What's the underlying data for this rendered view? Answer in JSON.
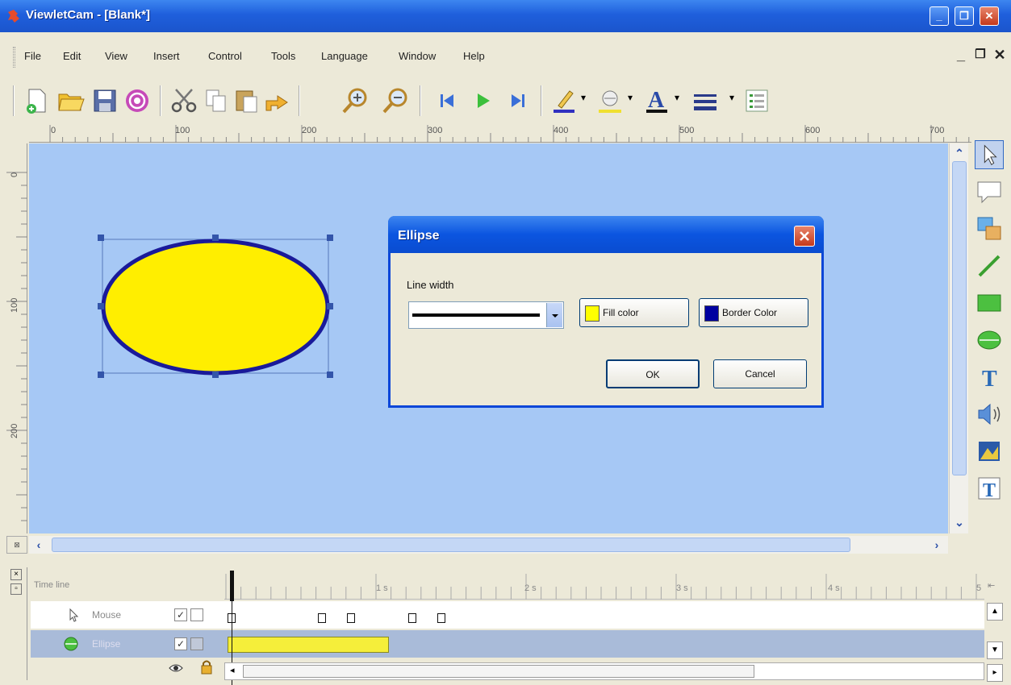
{
  "window": {
    "title": "ViewletCam - [Blank*]",
    "controls": {
      "minimize": "_",
      "restore": "❐",
      "close": "✕"
    }
  },
  "menubar": {
    "items": [
      "File",
      "Edit",
      "View",
      "Insert",
      "Control",
      "Tools",
      "Language",
      "Window",
      "Help"
    ],
    "mdi_controls": {
      "minimize": "_",
      "restore": "❐",
      "close": "✕"
    }
  },
  "ruler": {
    "h_labels": [
      "0",
      "100",
      "200",
      "300",
      "400",
      "500",
      "600",
      "700"
    ],
    "v_labels": [
      "0",
      "100",
      "200"
    ]
  },
  "dialog": {
    "title": "Ellipse",
    "line_width_label": "Line width",
    "fill_color_label": "Fill color",
    "border_color_label": "Border Color",
    "ok_label": "OK",
    "cancel_label": "Cancel",
    "fill_color": "#ffff00",
    "border_color": "#0000a0"
  },
  "shape": {
    "fill": "#ffee00",
    "stroke": "#1a1a9a"
  },
  "timeline": {
    "header": "Time line",
    "ticks": [
      "1 s",
      "2 s",
      "3 s",
      "4 s",
      "5"
    ],
    "rows": [
      {
        "name": "Mouse",
        "icon": "cursor-icon"
      },
      {
        "name": "Ellipse",
        "icon": "ellipse-icon"
      }
    ]
  },
  "colors": {
    "canvas": "#a6c8f5",
    "title_bar": "#1f5fdc",
    "timeline_bar": "#f5ee3a",
    "selected_row": "#a9bbd9"
  }
}
